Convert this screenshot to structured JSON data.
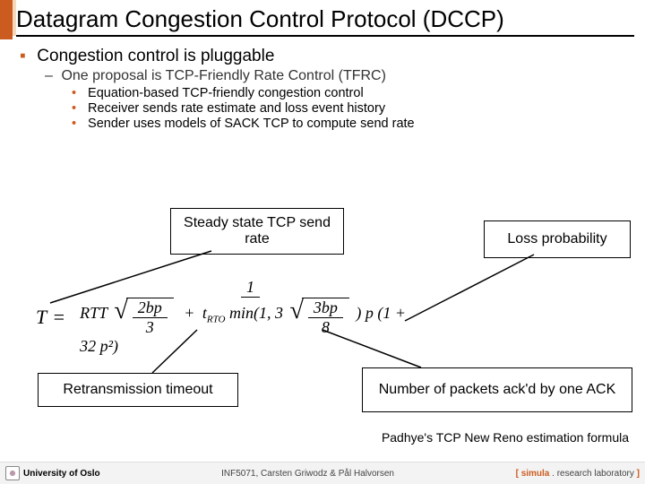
{
  "title": "Datagram Congestion Control Protocol (DCCP)",
  "bullets": {
    "l1": "Congestion control is pluggable",
    "l2": "One proposal is TCP-Friendly Rate Control (TFRC)",
    "l3a": "Equation-based TCP-friendly congestion control",
    "l3b": "Receiver sends rate estimate and loss event history",
    "l3c": "Sender uses models of SACK TCP to compute send rate"
  },
  "boxes": {
    "steady": "Steady state TCP send rate",
    "lossprob": "Loss probability",
    "rto": "Retransmission timeout",
    "ack": "Number of packets ack'd by one ACK"
  },
  "formula": {
    "T": "T",
    "eq": "=",
    "one": "1",
    "RTT": "RTT",
    "twobp": "2bp",
    "three": "3",
    "plus": "+",
    "trto": "t",
    "rto_sub": "RTO",
    "min": " min(1, 3",
    "threebp": "3bp",
    "eight": "8",
    "tail": ") p (1 + 32 p²)",
    "close": ""
  },
  "caption": "Padhye's TCP New Reno estimation formula",
  "footer": {
    "uni": "University of Oslo",
    "course": "INF5071, Carsten Griwodz & Pål Halvorsen",
    "simula_open": "[",
    "simula_name": "simula",
    "simula_rest": " . research laboratory ",
    "simula_close": "]"
  }
}
